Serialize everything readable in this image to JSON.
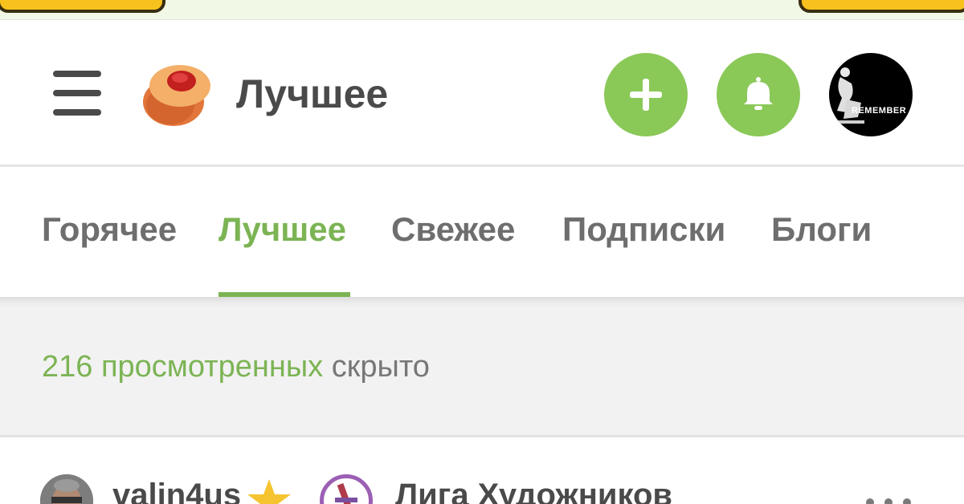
{
  "header": {
    "title": "Лучшее",
    "menu_icon": "hamburger-menu-icon",
    "logo_icon": "pikabu-logo-icon",
    "add_icon": "plus-icon",
    "notifications_icon": "bell-icon",
    "profile_avatar_text": "REMEMBER"
  },
  "tabs": [
    {
      "label": "Горячее",
      "active": false
    },
    {
      "label": "Лучшее",
      "active": true
    },
    {
      "label": "Свежее",
      "active": false
    },
    {
      "label": "Подписки",
      "active": false
    },
    {
      "label": "Блоги",
      "active": false
    }
  ],
  "hidden_info": {
    "link_text": "216 просмотренных",
    "rest_text": "скрыто"
  },
  "post": {
    "username": "valin4us",
    "badge_icon": "star-icon",
    "community": "Лига Художников",
    "more_icon": "more-dots-icon"
  },
  "colors": {
    "accent_green": "#8ac858",
    "active_tab": "#7cb454",
    "text_dark": "#4a4a4a",
    "text_gray": "#6e6e6e",
    "banner_yellow": "#f7c21d"
  }
}
